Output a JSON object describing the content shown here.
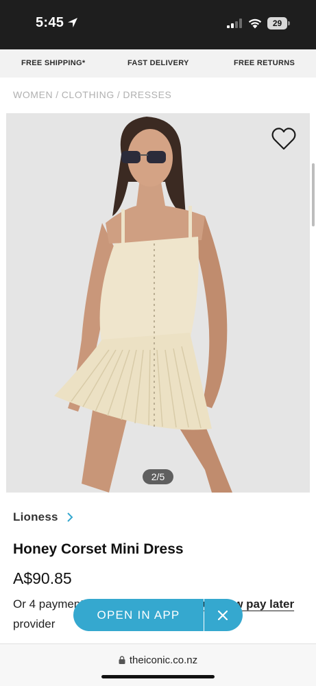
{
  "status_bar": {
    "time": "5:45",
    "battery": "29"
  },
  "promos": [
    "FREE SHIPPING*",
    "FAST DELIVERY",
    "FREE RETURNS"
  ],
  "breadcrumb": [
    "WOMEN",
    "CLOTHING",
    "DRESSES"
  ],
  "breadcrumb_separator": "/",
  "gallery": {
    "counter": "2/5"
  },
  "product": {
    "brand": "Lioness",
    "title": "Honey Corset Mini Dress",
    "price": "A$90.85",
    "payment_prefix": "Or 4 payments of A$10.75 with ",
    "payment_link": "Laybuy now pay later",
    "payment_suffix": " provider"
  },
  "banner": {
    "open_label": "OPEN IN APP"
  },
  "browser": {
    "url": "theiconic.co.nz"
  },
  "colors": {
    "accent": "#35a8cf",
    "status_bar": "#1e1e1e",
    "image_bg": "#e5e5e5"
  }
}
